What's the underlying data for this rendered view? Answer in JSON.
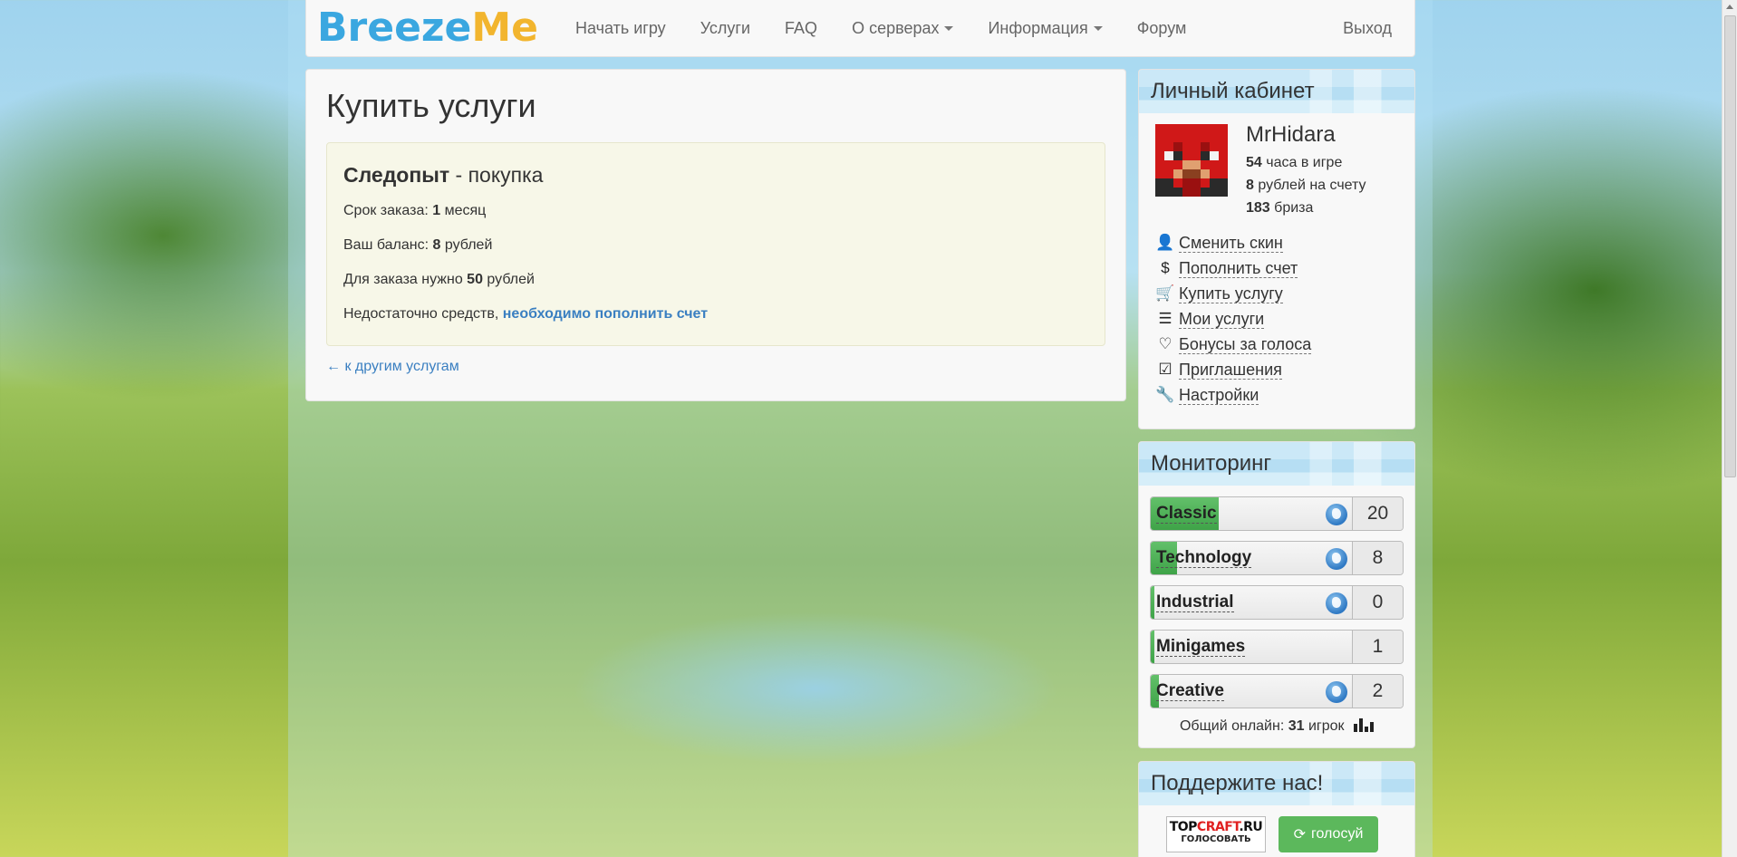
{
  "navbar": {
    "brand_part1": "Breeze",
    "brand_part2": "Me",
    "items": [
      "Начать игру",
      "Услуги",
      "FAQ",
      "О серверах",
      "Информация",
      "Форум"
    ],
    "exit": "Выход"
  },
  "main": {
    "title": "Купить услуги",
    "order": {
      "name": "Следопыт",
      "action": "- покупка",
      "term_label": "Срок заказа:",
      "term_value": "1",
      "term_unit": "месяц",
      "balance_label": "Ваш баланс:",
      "balance_value": "8",
      "balance_unit": "рублей",
      "need_label": "Для заказа нужно",
      "need_value": "50",
      "need_unit": "рублей",
      "insufficient_text": "Недостаточно средств,",
      "topup_link": "необходимо пополнить счет"
    },
    "back_link": "← к другим услугам"
  },
  "cabinet": {
    "title": "Личный кабинет",
    "username": "MrHidara",
    "hours_value": "54",
    "hours_label": "часа в игре",
    "rubles_value": "8",
    "rubles_label": "рублей на счету",
    "breeze_value": "183",
    "breeze_label": "бриза",
    "menu": [
      {
        "label": "Сменить скин",
        "icon": "user-icon"
      },
      {
        "label": "Пополнить счет",
        "icon": "dollar-icon"
      },
      {
        "label": "Купить услугу",
        "icon": "cart-icon"
      },
      {
        "label": "Мои услуги",
        "icon": "list-icon"
      },
      {
        "label": "Бонусы за голоса",
        "icon": "heart-icon"
      },
      {
        "label": "Приглашения",
        "icon": "check-square-icon"
      },
      {
        "label": "Настройки",
        "icon": "wrench-icon"
      }
    ]
  },
  "monitoring": {
    "title": "Мониторинг",
    "servers": [
      {
        "name": "Classic",
        "count": "20",
        "load": 0.34,
        "globe": true
      },
      {
        "name": "Technology",
        "count": "8",
        "load": 0.13,
        "globe": true
      },
      {
        "name": "Industrial",
        "count": "0",
        "load": 0.0,
        "globe": true
      },
      {
        "name": "Minigames",
        "count": "1",
        "load": 0.02,
        "globe": false
      },
      {
        "name": "Creative",
        "count": "2",
        "load": 0.04,
        "globe": true
      }
    ],
    "total_label": "Общий онлайн:",
    "total_value": "31",
    "total_unit": "игрок"
  },
  "support": {
    "title": "Поддержите нас!",
    "topcraft_part1": "TOP",
    "topcraft_part2": "CRAFT",
    "topcraft_part3": ".RU",
    "topcraft_sub": "ГОЛОСОВАТЬ",
    "vote_label": "голосуй"
  },
  "colors": {
    "brand_blue": "#3aa7e0",
    "brand_yellow": "#f2b52e",
    "link": "#3a7fc1",
    "monitor_green": "#4cae4c",
    "vote_green": "#5cb85c"
  }
}
